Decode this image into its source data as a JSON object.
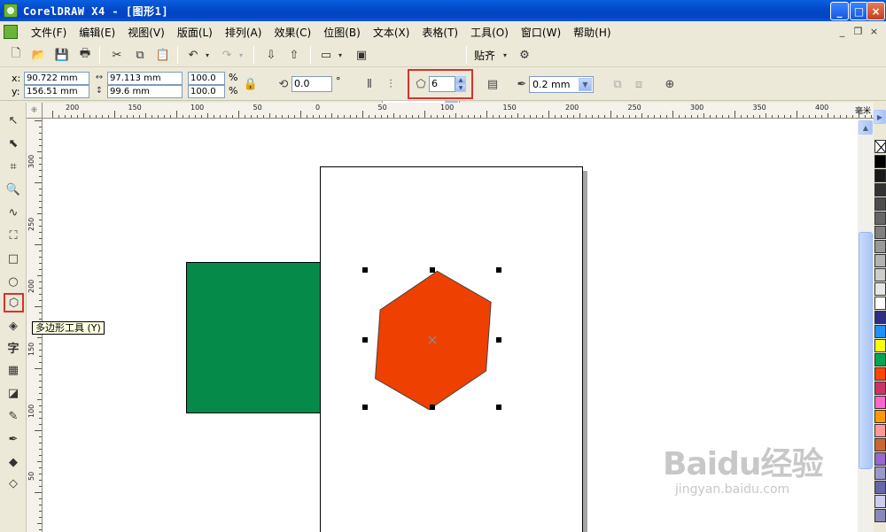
{
  "window": {
    "title": "CorelDRAW X4 - [图形1]",
    "buttons": {
      "minimize": "_",
      "maximize": "□",
      "close": "×"
    }
  },
  "menu": {
    "items": [
      "文件(F)",
      "编辑(E)",
      "视图(V)",
      "版面(L)",
      "排列(A)",
      "效果(C)",
      "位图(B)",
      "文本(X)",
      "表格(T)",
      "工具(O)",
      "窗口(W)",
      "帮助(H)"
    ],
    "mdi_buttons": {
      "minimize": "_",
      "restore": "❐",
      "close": "×"
    }
  },
  "toolbar": {
    "zoom_level": "100%",
    "snap_label": "贴齐",
    "icons": [
      "new-icon",
      "open-icon",
      "save-icon",
      "print-icon",
      "cut-icon",
      "copy-icon",
      "paste-icon",
      "undo-icon",
      "redo-icon",
      "import-icon",
      "export-icon",
      "application-launcher-icon",
      "welcome-screen-icon",
      "options-icon"
    ]
  },
  "property_bar": {
    "x_label": "x:",
    "y_label": "y:",
    "x_value": "90.722 mm",
    "y_value": "156.51 mm",
    "width_value": "97.113 mm",
    "height_value": "99.6 mm",
    "scale_x": "100.0",
    "scale_y": "100.0",
    "percent": "%",
    "rotation": "0.0",
    "degree": "°",
    "polygon_sides": "6",
    "outline_width": "0.2 mm"
  },
  "rulers": {
    "unit": "毫米",
    "top_labels": [
      "200",
      "150",
      "100",
      "50",
      "0",
      "50",
      "100",
      "150",
      "200",
      "250",
      "300",
      "350",
      "400"
    ],
    "left_labels": [
      "300",
      "250",
      "200",
      "150",
      "100",
      "50"
    ]
  },
  "toolbox": {
    "tooltip": "多边形工具 (Y)",
    "tools": [
      "pick-tool",
      "shape-tool",
      "crop-tool",
      "zoom-tool",
      "freehand-tool",
      "smart-fill-tool",
      "rectangle-tool",
      "ellipse-tool",
      "polygon-tool",
      "basic-shapes-tool",
      "text-tool",
      "table-tool",
      "blend-tool",
      "eyedropper-tool",
      "outline-tool",
      "fill-tool",
      "interactive-fill-tool"
    ]
  },
  "canvas": {
    "rectangle_color": "#058a4a",
    "hexagon_color": "#ee4000",
    "hexagon_sides": 6
  },
  "palette": {
    "colors": [
      "#000000",
      "#1a1a1a",
      "#333333",
      "#4d4d4d",
      "#666666",
      "#808080",
      "#999999",
      "#b3b3b3",
      "#cccccc",
      "#e6e6e6",
      "#ffffff",
      "#2e2e8a",
      "#1e90ff",
      "#ffff00",
      "#00a651",
      "#ff4500",
      "#cc3366",
      "#ff66cc",
      "#ff9900",
      "#ff9999",
      "#cc6633",
      "#9966cc",
      "#9999cc",
      "#6666aa",
      "#ccccee",
      "#8888bb"
    ]
  },
  "watermark": {
    "brand": "Baidu经验",
    "url": "jingyan.baidu.com"
  }
}
